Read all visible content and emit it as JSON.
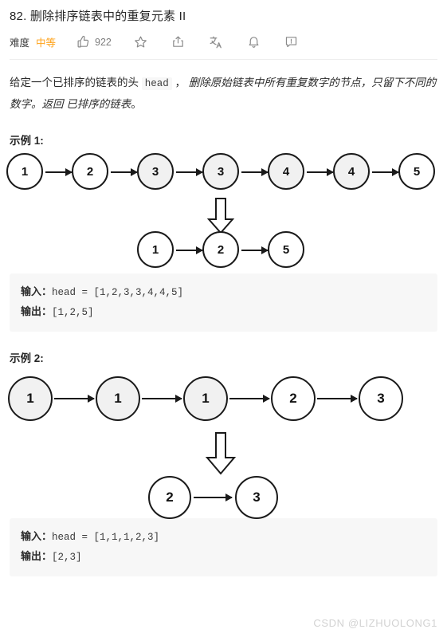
{
  "header": {
    "title": "82. 删除排序链表中的重复元素 II",
    "difficulty_label": "难度",
    "difficulty_value": "中等",
    "difficulty_color": "#ffa116",
    "like_count": "922",
    "icons": {
      "thumbs_up": "thumbs-up-icon",
      "star": "star-icon",
      "share": "share-icon",
      "translate": "translate-icon",
      "bell": "bell-icon",
      "feedback": "feedback-icon"
    }
  },
  "description": {
    "part1": "给定一个已排序的链表的头 ",
    "code": "head",
    "part2": " ，",
    "part3": " 删除原始链表中所有重复数字的节点，只留下不同的数字。返回 ",
    "part4": "已排序的链表",
    "part5": "。"
  },
  "examples": [
    {
      "heading": "示例 1:",
      "input_nodes": [
        {
          "value": "1",
          "shaded": false
        },
        {
          "value": "2",
          "shaded": false
        },
        {
          "value": "3",
          "shaded": true
        },
        {
          "value": "3",
          "shaded": true
        },
        {
          "value": "4",
          "shaded": true
        },
        {
          "value": "4",
          "shaded": true
        },
        {
          "value": "5",
          "shaded": false
        }
      ],
      "output_nodes": [
        {
          "value": "1",
          "shaded": false
        },
        {
          "value": "2",
          "shaded": false
        },
        {
          "value": "5",
          "shaded": false
        }
      ],
      "input_label": "输入：",
      "input_code": "head = [1,2,3,3,4,4,5]",
      "output_label": "输出：",
      "output_code": "[1,2,5]"
    },
    {
      "heading": "示例 2:",
      "input_nodes": [
        {
          "value": "1",
          "shaded": true
        },
        {
          "value": "1",
          "shaded": true
        },
        {
          "value": "1",
          "shaded": true
        },
        {
          "value": "2",
          "shaded": false
        },
        {
          "value": "3",
          "shaded": false
        }
      ],
      "output_nodes": [
        {
          "value": "2",
          "shaded": false
        },
        {
          "value": "3",
          "shaded": false
        }
      ],
      "input_label": "输入：",
      "input_code": "head = [1,1,1,2,3]",
      "output_label": "输出：",
      "output_code": "[2,3]"
    }
  ],
  "watermark": "CSDN @LIZHUOLONG1"
}
